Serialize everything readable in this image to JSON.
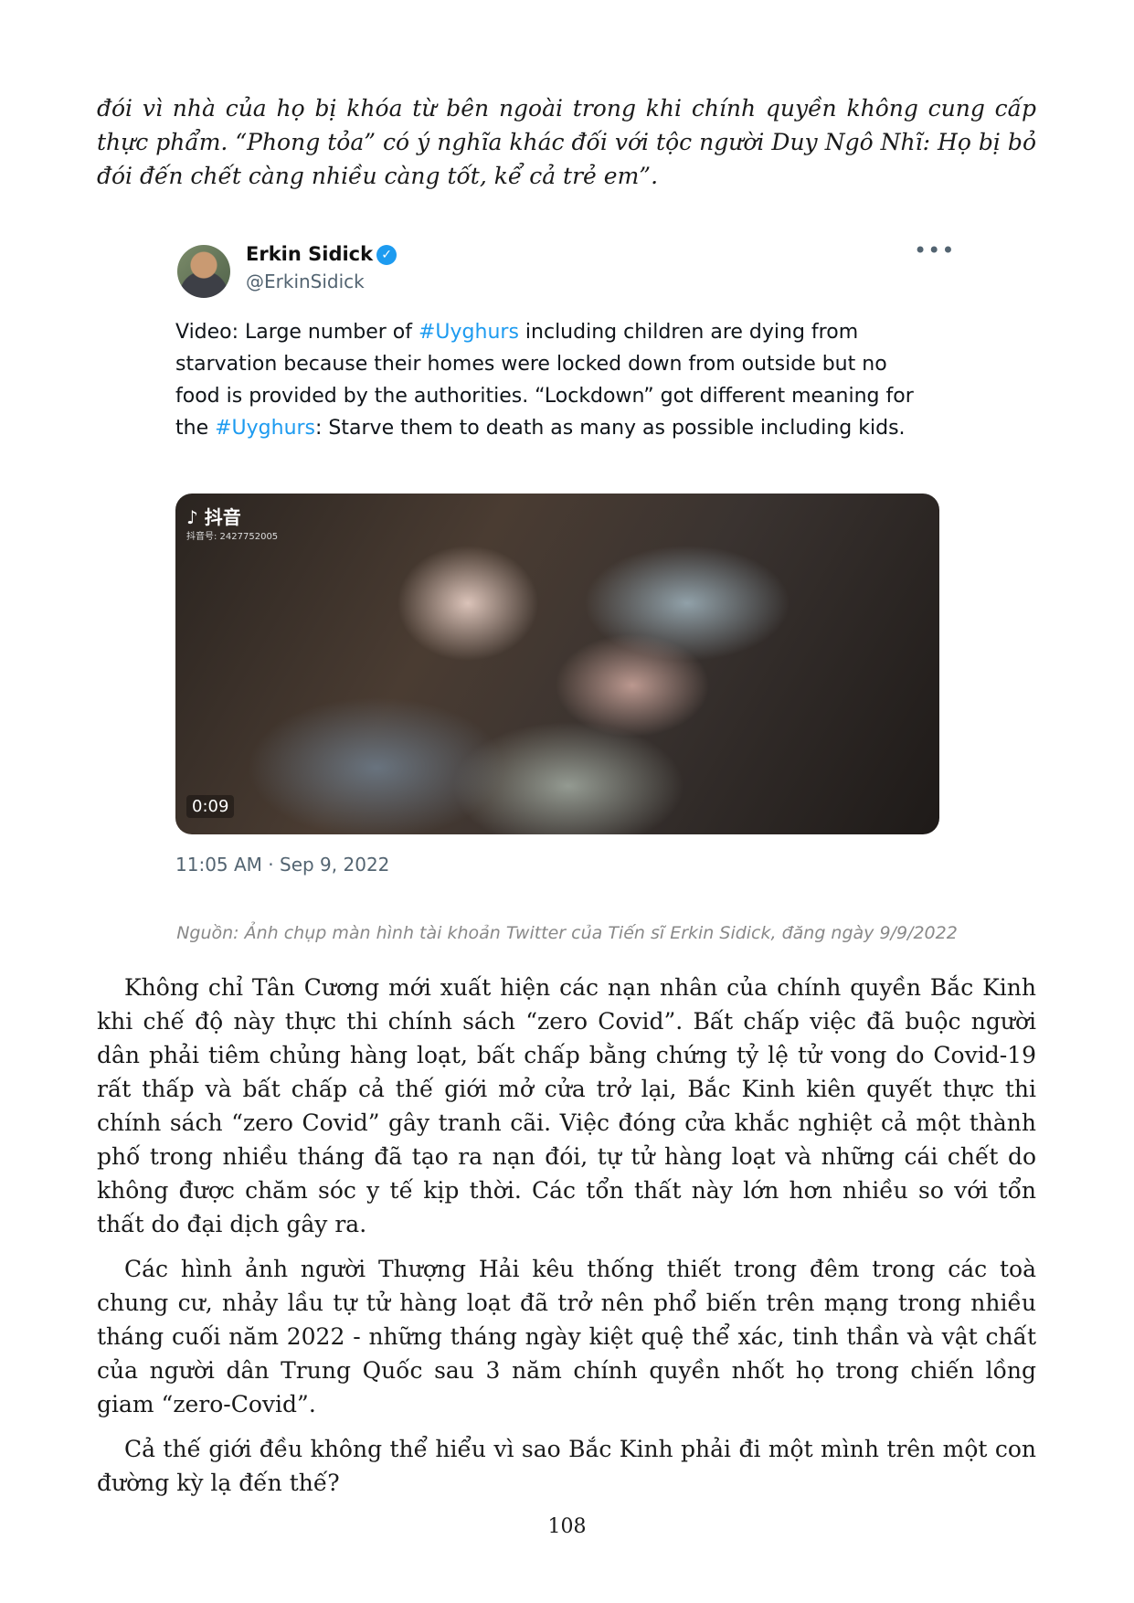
{
  "intro_paragraph": "đói vì nhà của họ bị khóa từ bên ngoài trong khi chính quyền không cung cấp thực phẩm. “Phong tỏa” có ý nghĩa khác đối với tộc người Duy Ngô Nhĩ: Họ bị bỏ đói đến chết càng nhiều càng tốt, kể cả trẻ em”.",
  "tweet": {
    "name": "Erkin Sidick",
    "handle": "@ErkinSidick",
    "more_icon": "more-horizontal-icon",
    "text": {
      "part1": "Video: Large number of ",
      "hashtag1": "#Uyghurs",
      "part2": " including children are dying from starvation because their homes were locked down from outside but no food is provided by the authorities. “Lockdown” got different meaning for the ",
      "hashtag2": "#Uyghurs",
      "part3": ": Starve them to death as many as possible including kids."
    },
    "video": {
      "logo": "抖音",
      "watermark_id": "抖音号: 2427752005",
      "duration": "0:09"
    },
    "timestamp": "11:05 AM · Sep 9, 2022"
  },
  "caption": "Nguồn: Ảnh chụp màn hình tài khoản Twitter của Tiến sĩ Erkin Sidick, đăng ngày 9/9/2022",
  "paragraphs": [
    "Không chỉ Tân Cương mới xuất hiện các nạn nhân của chính quyền Bắc Kinh khi chế độ này thực thi chính sách “zero Covid”. Bất chấp việc đã buộc người dân phải tiêm chủng hàng loạt, bất chấp bằng chứng tỷ lệ tử vong do Covid-19 rất thấp và bất chấp cả thế giới mở cửa trở lại, Bắc Kinh kiên quyết thực thi chính sách “zero Covid” gây tranh cãi. Việc đóng cửa khắc nghiệt cả một thành phố trong nhiều tháng đã tạo ra nạn đói, tự tử hàng loạt và những cái chết do không được chăm sóc y tế kịp thời. Các tổn thất này lớn hơn nhiều so với tổn thất do đại dịch gây ra.",
    "Các hình ảnh người Thượng Hải kêu thống thiết trong đêm trong các toà chung cư, nhảy lầu tự tử hàng loạt đã trở nên phổ biến trên mạng trong nhiều tháng cuối năm 2022 - những tháng ngày kiệt quệ thể xác, tinh thần và vật chất của người dân Trung Quốc sau 3 năm chính quyền nhốt họ trong chiến lồng giam “zero-Covid”.",
    "Cả thế giới đều không thể hiểu vì sao Bắc Kinh phải đi một mình trên một con đường kỳ lạ đến thế?"
  ],
  "page_number": "108"
}
